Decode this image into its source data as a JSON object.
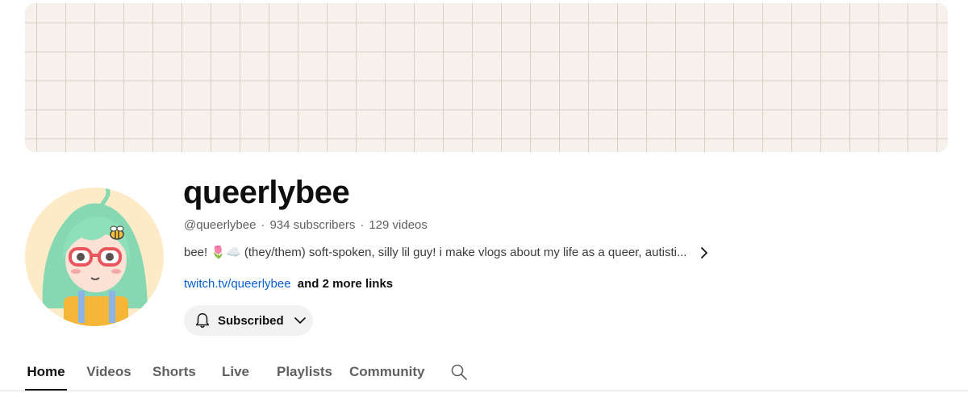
{
  "channel": {
    "name": "queerlybee",
    "handle": "@queerlybee",
    "subscribers": "934 subscribers",
    "videos": "129 videos",
    "separator": "·",
    "description": "bee! 🌷☁️ (they/them) soft-spoken, silly lil guy! i make vlogs about my life as a queer, autisti...",
    "link": "twitch.tv/queerlybee",
    "more_links": "and 2 more links"
  },
  "subscribe_button": {
    "label": "Subscribed"
  },
  "tabs": [
    {
      "label": "Home",
      "active": true
    },
    {
      "label": "Videos",
      "active": false
    },
    {
      "label": "Shorts",
      "active": false
    },
    {
      "label": "Live",
      "active": false
    },
    {
      "label": "Playlists",
      "active": false
    },
    {
      "label": "Community",
      "active": false
    }
  ],
  "icons": {
    "bell": "bell-icon",
    "chevron_down": "chevron-down-icon",
    "chevron_right": "chevron-right-icon",
    "search": "search-icon",
    "avatar": "channel-avatar"
  },
  "colors": {
    "banner_bg": "#f6f1ea",
    "banner_grid": "#d9cfc6",
    "link": "#065fd4",
    "subscribe_bg": "#f2f2f2",
    "avatar_bg": "#fdebc8"
  }
}
